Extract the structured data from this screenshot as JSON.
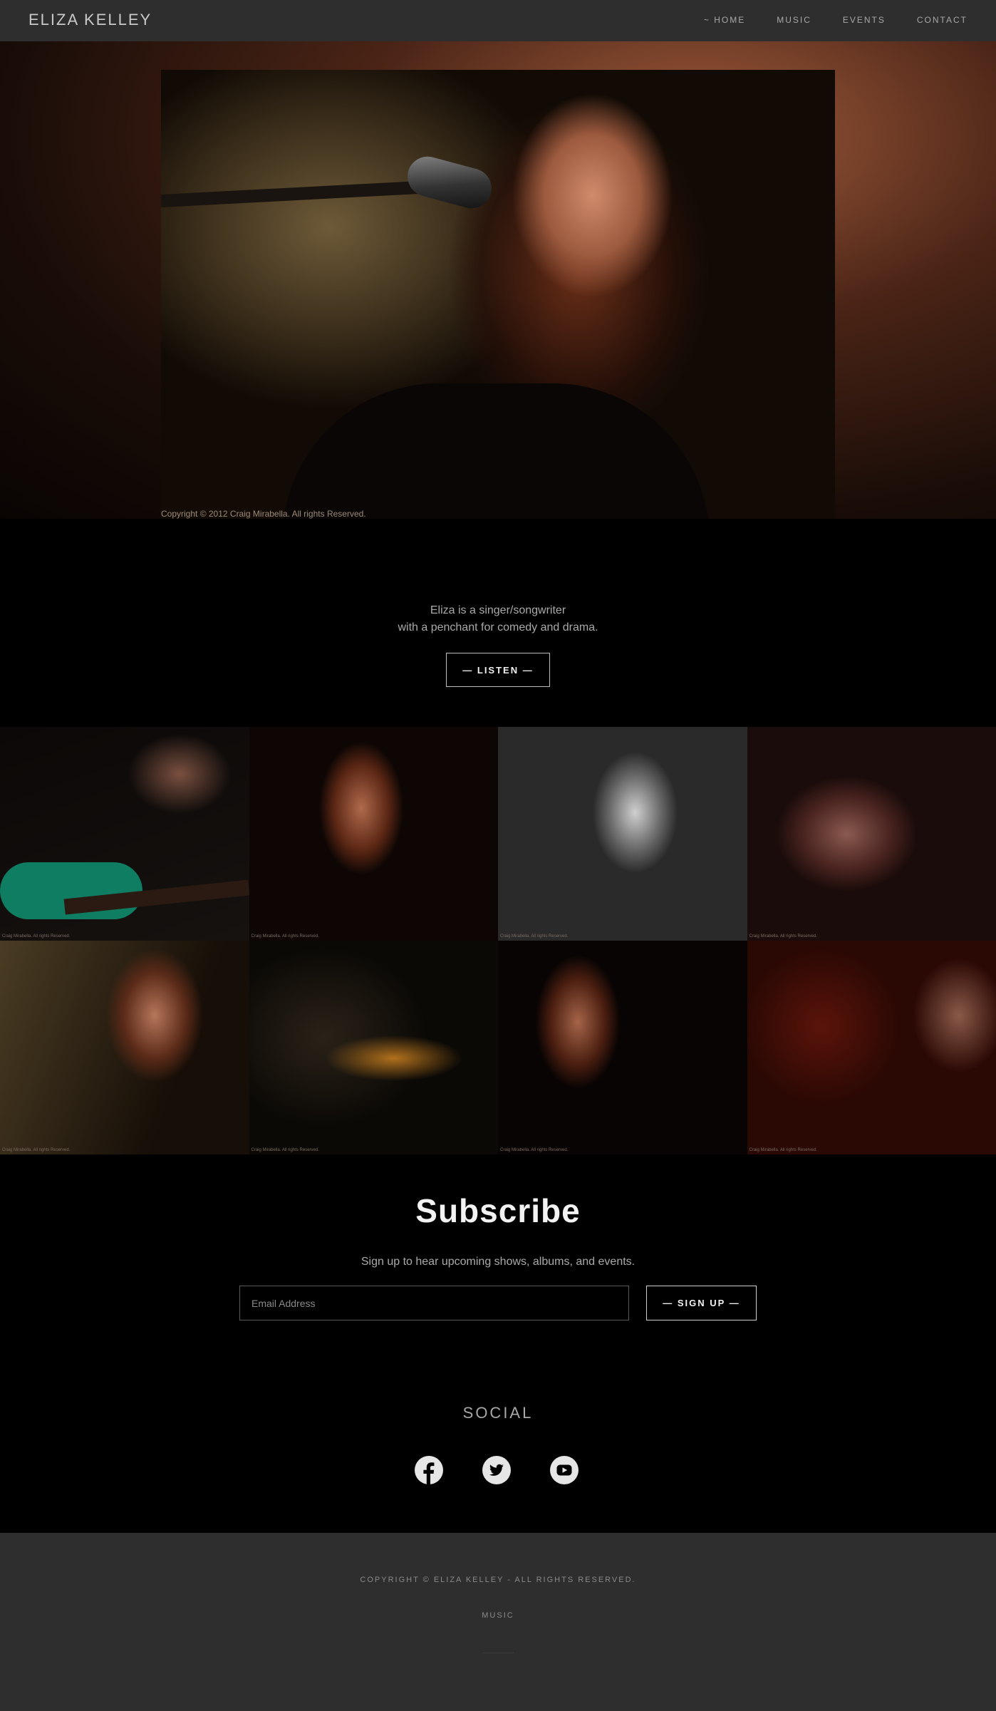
{
  "header": {
    "brand": "ELIZA KELLEY",
    "nav": [
      "HOME",
      "MUSIC",
      "EVENTS",
      "CONTACT"
    ],
    "active_nav": "HOME"
  },
  "hero": {
    "caption": "Copyright © 2012 Craig Mirabella. All rights Reserved."
  },
  "intro": {
    "line1": "Eliza is a singer/songwriter",
    "line2": "with a penchant for comedy and drama.",
    "button": "— LISTEN —"
  },
  "gallery": {
    "watermark": "Craig Mirabella. All rights Reserved."
  },
  "subscribe": {
    "title": "Subscribe",
    "description": "Sign up to hear upcoming shows, albums, and events.",
    "email_placeholder": "Email Address",
    "button": "— SIGN UP —"
  },
  "social": {
    "title": "SOCIAL",
    "icons": [
      "facebook-icon",
      "twitter-icon",
      "youtube-icon"
    ]
  },
  "footer": {
    "copyright": "COPYRIGHT © ELIZA KELLEY - ALL RIGHTS RESERVED.",
    "link": "MUSIC"
  },
  "colors": {
    "header_bg": "#2e2e2e",
    "page_bg": "#000000",
    "text_muted": "#a9a9a9"
  }
}
